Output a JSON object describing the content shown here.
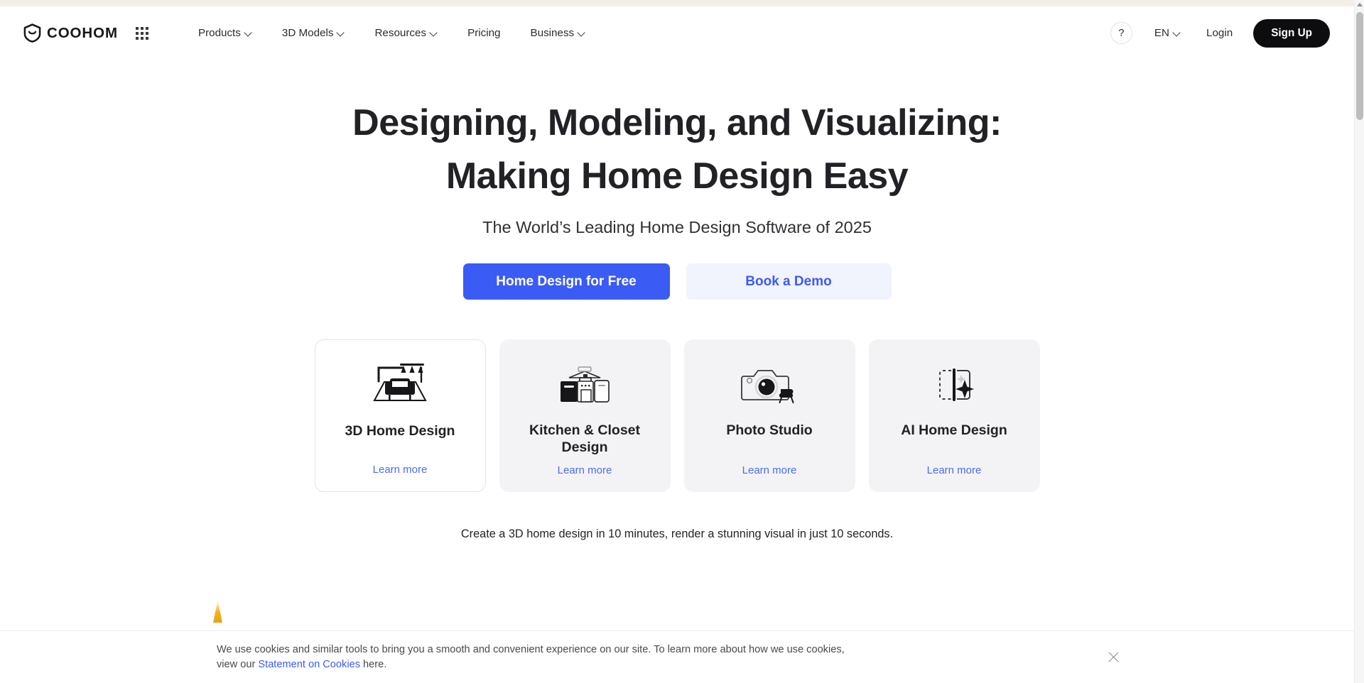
{
  "header": {
    "logo_text": "COOHOM",
    "logo_icon": "shield-smile-logo-icon",
    "apps_icon": "apps-grid-icon",
    "nav_items": [
      {
        "label": "Products",
        "has_chevron": true
      },
      {
        "label": "3D Models",
        "has_chevron": true
      },
      {
        "label": "Resources",
        "has_chevron": true
      },
      {
        "label": "Pricing",
        "has_chevron": false
      },
      {
        "label": "Business",
        "has_chevron": true
      }
    ],
    "help_label": "?",
    "language": "EN",
    "login_label": "Login",
    "signup_label": "Sign Up"
  },
  "hero": {
    "title": "Designing, Modeling, and Visualizing: Making Home Design Easy",
    "subtitle": "The World’s Leading Home Design Software of 2025",
    "primary_cta": "Home Design for Free",
    "secondary_cta": "Book a Demo",
    "tagline": "Create a 3D home design in 10 minutes, render a stunning visual in just 10 seconds."
  },
  "cards": [
    {
      "title": "3D Home Design",
      "link_label": "Learn more",
      "icon": "room-sofa-icon",
      "active": true
    },
    {
      "title": "Kitchen & Closet Design",
      "link_label": "Learn more",
      "icon": "kitchen-cabinet-icon",
      "active": false
    },
    {
      "title": "Photo Studio",
      "link_label": "Learn more",
      "icon": "camera-armchair-icon",
      "active": false
    },
    {
      "title": "AI Home Design",
      "link_label": "Learn more",
      "icon": "ai-sparkle-panel-icon",
      "active": false
    }
  ],
  "cookie_banner": {
    "text_before_link": "We use cookies and similar tools to bring you a smooth and convenient experience on our site. To learn more about how we use cookies, view our ",
    "link_label": "Statement on Cookies",
    "text_after_link": " here.",
    "close_icon": "close-icon"
  },
  "colors": {
    "accent_blue": "#3b5bf5",
    "link_blue": "#4a6cf7",
    "signup_black": "#0d0d0f",
    "card_gray": "#f3f3f5",
    "secondary_btn": "#f1f4fd",
    "spike_yellow": "#f2b01f",
    "top_strip": "#f3efe6"
  }
}
